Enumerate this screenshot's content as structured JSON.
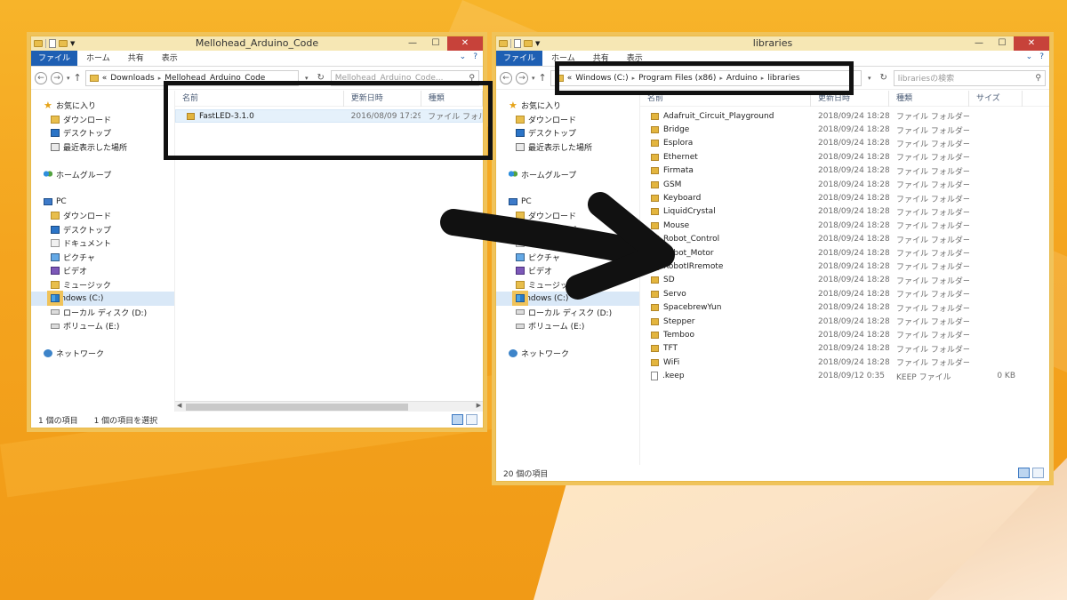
{
  "left_window": {
    "title": "Mellohead_Arduino_Code",
    "ribbon_tabs": {
      "file": "ファイル",
      "home": "ホーム",
      "share": "共有",
      "view": "表示"
    },
    "address": {
      "prefix": "«",
      "crumbs": [
        "Downloads",
        "Mellohead_Arduino_Code"
      ]
    },
    "search_placeholder": "Mellohead_Arduino_Code...",
    "columns": {
      "name": "名前",
      "modified": "更新日時",
      "type": "種類"
    },
    "files": [
      {
        "name": "FastLED-3.1.0",
        "date": "2016/08/09 17:29",
        "type": "ファイル フォルダー"
      }
    ],
    "status": {
      "count": "1 個の項目",
      "selected": "1 個の項目を選択"
    }
  },
  "right_window": {
    "title": "libraries",
    "ribbon_tabs": {
      "file": "ファイル",
      "home": "ホーム",
      "share": "共有",
      "view": "表示"
    },
    "address": {
      "prefix": "«",
      "crumbs": [
        "Windows (C:)",
        "Program Files (x86)",
        "Arduino",
        "libraries"
      ]
    },
    "search_placeholder": "librariesの検索",
    "columns": {
      "name": "名前",
      "modified": "更新日時",
      "type": "種類",
      "size": "サイズ"
    },
    "files": [
      {
        "name": "Adafruit_Circuit_Playground",
        "date": "2018/09/24 18:28",
        "type": "ファイル フォルダー",
        "size": "",
        "icon": "folder"
      },
      {
        "name": "Bridge",
        "date": "2018/09/24 18:28",
        "type": "ファイル フォルダー",
        "size": "",
        "icon": "folder"
      },
      {
        "name": "Esplora",
        "date": "2018/09/24 18:28",
        "type": "ファイル フォルダー",
        "size": "",
        "icon": "folder"
      },
      {
        "name": "Ethernet",
        "date": "2018/09/24 18:28",
        "type": "ファイル フォルダー",
        "size": "",
        "icon": "folder"
      },
      {
        "name": "Firmata",
        "date": "2018/09/24 18:28",
        "type": "ファイル フォルダー",
        "size": "",
        "icon": "folder"
      },
      {
        "name": "GSM",
        "date": "2018/09/24 18:28",
        "type": "ファイル フォルダー",
        "size": "",
        "icon": "folder"
      },
      {
        "name": "Keyboard",
        "date": "2018/09/24 18:28",
        "type": "ファイル フォルダー",
        "size": "",
        "icon": "folder"
      },
      {
        "name": "LiquidCrystal",
        "date": "2018/09/24 18:28",
        "type": "ファイル フォルダー",
        "size": "",
        "icon": "folder"
      },
      {
        "name": "Mouse",
        "date": "2018/09/24 18:28",
        "type": "ファイル フォルダー",
        "size": "",
        "icon": "folder"
      },
      {
        "name": "Robot_Control",
        "date": "2018/09/24 18:28",
        "type": "ファイル フォルダー",
        "size": "",
        "icon": "folder"
      },
      {
        "name": "Robot_Motor",
        "date": "2018/09/24 18:28",
        "type": "ファイル フォルダー",
        "size": "",
        "icon": "folder"
      },
      {
        "name": "RobotIRremote",
        "date": "2018/09/24 18:28",
        "type": "ファイル フォルダー",
        "size": "",
        "icon": "folder"
      },
      {
        "name": "SD",
        "date": "2018/09/24 18:28",
        "type": "ファイル フォルダー",
        "size": "",
        "icon": "folder"
      },
      {
        "name": "Servo",
        "date": "2018/09/24 18:28",
        "type": "ファイル フォルダー",
        "size": "",
        "icon": "folder"
      },
      {
        "name": "SpacebrewYun",
        "date": "2018/09/24 18:28",
        "type": "ファイル フォルダー",
        "size": "",
        "icon": "folder"
      },
      {
        "name": "Stepper",
        "date": "2018/09/24 18:28",
        "type": "ファイル フォルダー",
        "size": "",
        "icon": "folder"
      },
      {
        "name": "Temboo",
        "date": "2018/09/24 18:28",
        "type": "ファイル フォルダー",
        "size": "",
        "icon": "folder"
      },
      {
        "name": "TFT",
        "date": "2018/09/24 18:28",
        "type": "ファイル フォルダー",
        "size": "",
        "icon": "folder"
      },
      {
        "name": "WiFi",
        "date": "2018/09/24 18:28",
        "type": "ファイル フォルダー",
        "size": "",
        "icon": "folder"
      },
      {
        "name": ".keep",
        "date": "2018/09/12 0:35",
        "type": "KEEP ファイル",
        "size": "0 KB",
        "icon": "file"
      }
    ],
    "status": {
      "count": "20 個の項目"
    }
  },
  "navigation_pane": {
    "favorites": "お気に入り",
    "downloads": "ダウンロード",
    "desktop": "デスクトップ",
    "recent": "最近表示した場所",
    "homegroup": "ホームグループ",
    "pc": "PC",
    "pc_downloads": "ダウンロード",
    "pc_desktop": "デスクトップ",
    "documents": "ドキュメント",
    "pictures": "ピクチャ",
    "videos": "ビデオ",
    "music": "ミュージック",
    "windows_c": "Windows (C:)",
    "local_d": "ローカル ディスク (D:)",
    "volume_e": "ボリューム (E:)",
    "network": "ネットワーク"
  },
  "colors": {
    "desktop": "#f4a51f",
    "ribbon_file_tab": "#1e5fb3",
    "close_button": "#c7423a",
    "annotation": "#111111"
  }
}
